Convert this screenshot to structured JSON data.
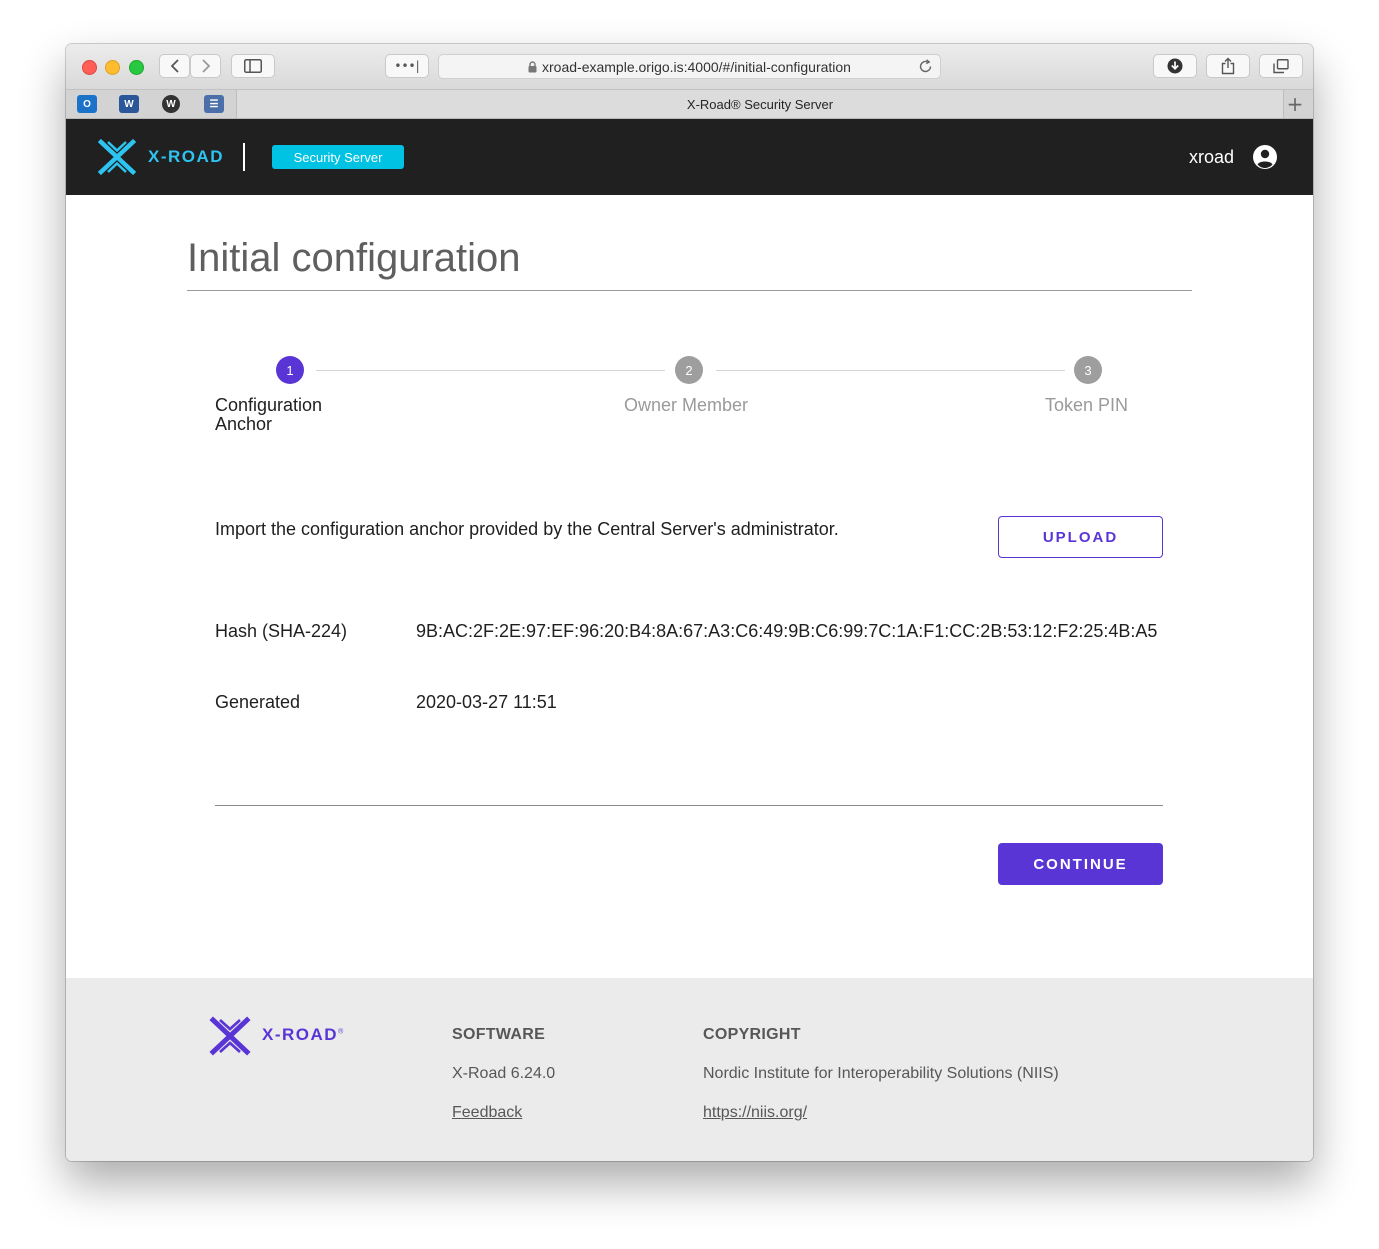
{
  "browser": {
    "url": "xroad-example.origo.is:4000/#/initial-configuration",
    "tab_title": "X-Road® Security Server",
    "more_button": "•••|",
    "new_tab": "+",
    "favicons": [
      {
        "name": "outlook-icon",
        "glyph": "O",
        "color": "#1a73c9"
      },
      {
        "name": "word-icon",
        "glyph": "W",
        "color": "#2b579a"
      },
      {
        "name": "w-app-icon",
        "glyph": "W",
        "color": "#333333"
      },
      {
        "name": "tasks-icon",
        "glyph": "☰",
        "color": "#4b6fa8"
      }
    ]
  },
  "header": {
    "logo_text": "X-ROAD",
    "badge": "Security Server",
    "username": "xroad"
  },
  "page": {
    "title": "Initial configuration"
  },
  "stepper": {
    "steps": [
      {
        "number": "1",
        "label_line1": "Configuration",
        "label_line2": "Anchor",
        "active": true
      },
      {
        "number": "2",
        "label": "Owner Member",
        "active": false
      },
      {
        "number": "3",
        "label": "Token PIN",
        "active": false
      }
    ]
  },
  "anchor": {
    "intro": "Import the configuration anchor provided by the Central Server's administrator.",
    "upload_label": "UPLOAD",
    "hash_label": "Hash (SHA-224)",
    "hash_value": "9B:AC:2F:2E:97:EF:96:20:B4:8A:67:A3:C6:49:9B:C6:99:7C:1A:F1:CC:2B:53:12:F2:25:4B:A5",
    "generated_label": "Generated",
    "generated_value": "2020-03-27 11:51",
    "continue_label": "CONTINUE"
  },
  "footer": {
    "logo_text": "X-ROAD",
    "logo_mark": "®",
    "software_heading": "SOFTWARE",
    "version": "X-Road 6.24.0",
    "feedback": "Feedback",
    "copyright_heading": "COPYRIGHT",
    "org": "Nordic Institute for Interoperability Solutions (NIIS)",
    "org_url": "https://niis.org/"
  },
  "colors": {
    "accent": "#5a35d6",
    "badge": "#00c3e4",
    "header_bg": "#202020",
    "logo_cyan": "#2ec4f2",
    "step_inactive": "#9e9e9e"
  }
}
